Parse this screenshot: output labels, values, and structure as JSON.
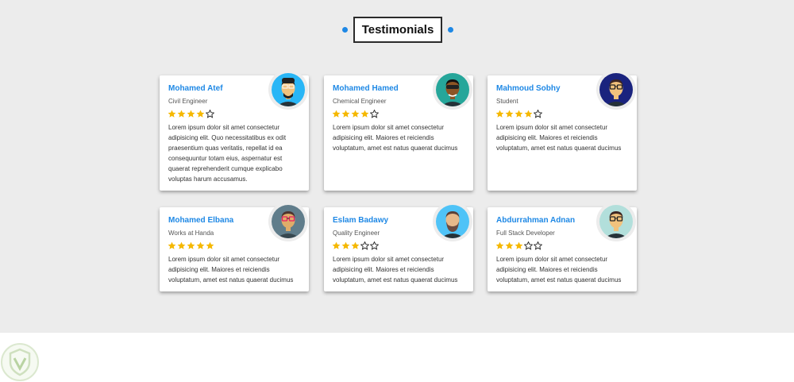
{
  "section": {
    "title": "Testimonials"
  },
  "testimonials": [
    {
      "name": "Mohamed Atef",
      "role": "Civil Engineer",
      "rating": 4,
      "text": "Lorem ipsum dolor sit amet consectetur adipisicing elit. Quo necessitatibus ex odit praesentium quas veritatis, repellat id ea consequuntur totam eius, aspernatur est quaerat reprehenderit cumque explicabo voluptas harum accusamus.",
      "avatar_icon": "avatar-man-beanie-glasses-icon",
      "avatar_bg": "#29b6f6"
    },
    {
      "name": "Mohamed Hamed",
      "role": "Chemical Engineer",
      "rating": 4,
      "text": "Lorem ipsum dolor sit amet consectetur adipisicing elit. Maiores et reiciendis voluptatum, amet est natus quaerat ducimus",
      "avatar_icon": "avatar-man-sunglasses-icon",
      "avatar_bg": "#26a69a"
    },
    {
      "name": "Mahmoud Sobhy",
      "role": "Student",
      "rating": 4,
      "text": "Lorem ipsum dolor sit amet consectetur adipisicing elit. Maiores et reiciendis voluptatum, amet est natus quaerat ducimus",
      "avatar_icon": "avatar-man-glasses-icon",
      "avatar_bg": "#1a237e"
    },
    {
      "name": "Mohamed Elbana",
      "role": "Works at Handa",
      "rating": 5,
      "text": "Lorem ipsum dolor sit amet consectetur adipisicing elit. Maiores et reiciendis voluptatum, amet est natus quaerat ducimus",
      "avatar_icon": "avatar-man-pink-glasses-icon",
      "avatar_bg": "#607d8b"
    },
    {
      "name": "Eslam Badawy",
      "role": "Quality Engineer",
      "rating": 3,
      "text": "Lorem ipsum dolor sit amet consectetur adipisicing elit. Maiores et reiciendis voluptatum, amet est natus quaerat ducimus",
      "avatar_icon": "avatar-man-beard-icon",
      "avatar_bg": "#4fc3f7"
    },
    {
      "name": "Abdurrahman Adnan",
      "role": "Full Stack Developer",
      "rating": 3,
      "text": "Lorem ipsum dolor sit amet consectetur adipisicing elit. Maiores et reiciendis voluptatum, amet est natus quaerat ducimus",
      "avatar_icon": "avatar-man-black-glasses-icon",
      "avatar_bg": "#b2dfdb"
    }
  ],
  "colors": {
    "accent": "#1e88e5",
    "star": "#f5b800",
    "background": "#ececec"
  },
  "watermark": {
    "icon": "shield-v-logo-icon"
  }
}
